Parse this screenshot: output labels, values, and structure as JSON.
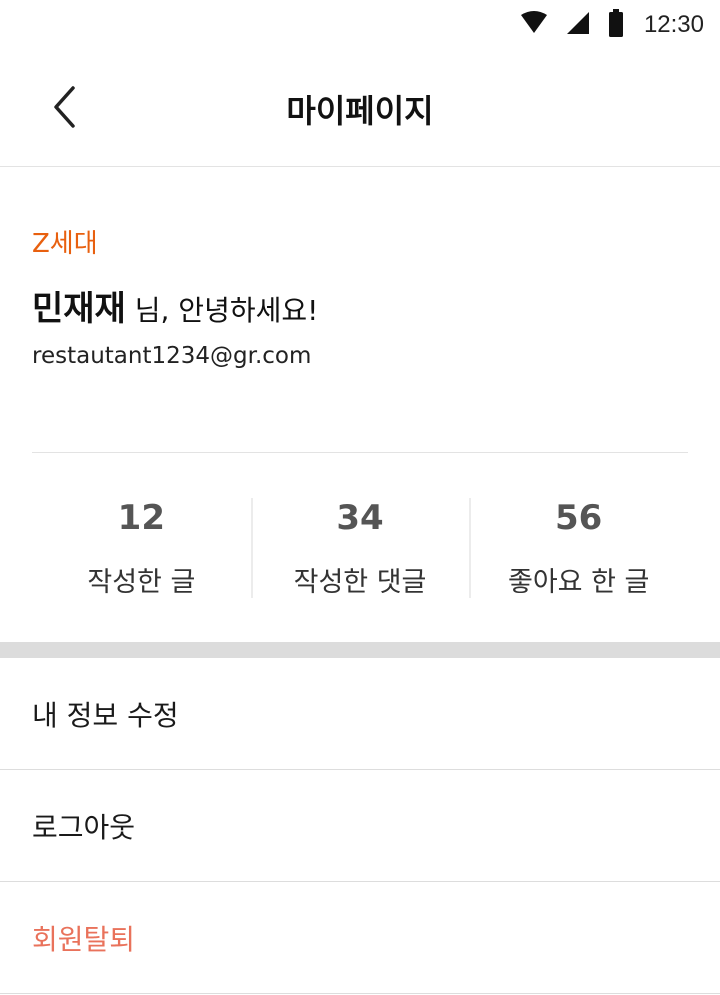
{
  "status_bar": {
    "time": "12:30",
    "icons": [
      "wifi-icon",
      "cellular-signal-icon",
      "battery-icon"
    ]
  },
  "header": {
    "back_icon": "chevron-left-icon",
    "title": "마이페이지"
  },
  "profile": {
    "badge": "Z세대",
    "name": "민재재",
    "greeting_suffix": " 님, 안녕하세요!",
    "email": "restautant1234@gr.com",
    "accent_color": "#e8600f"
  },
  "stats": [
    {
      "value": "12",
      "label": "작성한 글"
    },
    {
      "value": "34",
      "label": "작성한 댓글"
    },
    {
      "value": "56",
      "label": "좋아요 한 글"
    }
  ],
  "menu": {
    "items": [
      {
        "label": "내 정보 수정"
      },
      {
        "label": "로그아웃"
      },
      {
        "label": "회원탈퇴",
        "color": "#e9725b"
      }
    ]
  }
}
